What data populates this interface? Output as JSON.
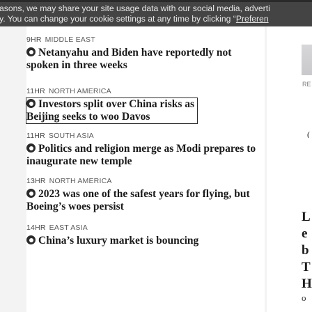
{
  "cookie_banner": {
    "line1": "asons, we may share your site usage data with our social media, adverti",
    "line2_prefix": "y. You can change your cookie settings at any time by clicking “",
    "preferences_link": "Preferen"
  },
  "feed": {
    "items": [
      {
        "age": "9HR",
        "region": "MIDDLE EAST",
        "headline": "Netanyahu and Biden have reportedly not spoken in three weeks"
      },
      {
        "age": "11HR",
        "region": "NORTH AMERICA",
        "headline_line1": "Investors split over China risks as",
        "headline_line2": "Beijing seeks to woo Davos"
      },
      {
        "age": "11HR",
        "region": "SOUTH ASIA",
        "headline": "Politics and religion merge as Modi prepares to inaugurate new temple"
      },
      {
        "age": "13HR",
        "region": "NORTH AMERICA",
        "headline": "2023 was one of the safest years for flying, but Boeing’s woes persist"
      },
      {
        "age": "14HR",
        "region": "EAST ASIA",
        "headline": "China’s luxury market is bouncing"
      }
    ]
  },
  "right_column": {
    "edge_text": "RE",
    "tick": "(",
    "letters": [
      "L",
      "e",
      "b",
      "T",
      "H",
      "o"
    ]
  }
}
